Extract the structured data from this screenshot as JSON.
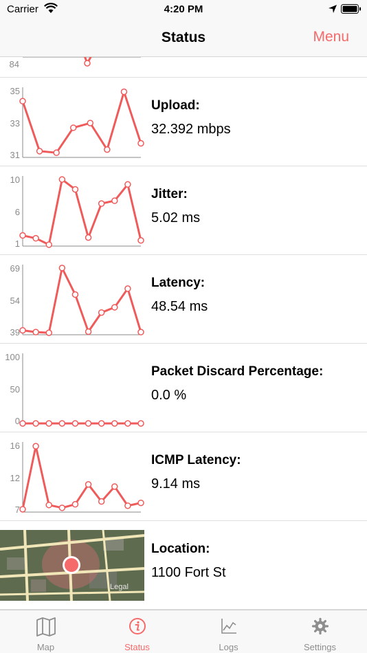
{
  "status_bar": {
    "carrier": "Carrier",
    "time": "4:20 PM"
  },
  "nav": {
    "title": "Status",
    "menu_label": "Menu"
  },
  "rows": [
    {
      "title": "",
      "value": "",
      "ticks": [
        "84"
      ],
      "chart": {
        "ylim": [
          84,
          99
        ],
        "values": []
      }
    },
    {
      "title": "Upload:",
      "value": "32.392 mbps",
      "ticks": [
        "35",
        "33",
        "31"
      ],
      "chart": {
        "ylim": [
          30.8,
          35.2
        ],
        "values": [
          34.4,
          31.2,
          31.1,
          32.7,
          33.0,
          31.3,
          35.0,
          31.7
        ]
      }
    },
    {
      "title": "Jitter:",
      "value": "5.02 ms",
      "ticks": [
        "10",
        "6",
        "1"
      ],
      "chart": {
        "ylim": [
          0.6,
          10.3
        ],
        "values": [
          2.1,
          1.7,
          0.8,
          10.0,
          8.6,
          1.8,
          6.6,
          7.0,
          9.3,
          1.4
        ]
      }
    },
    {
      "title": "Latency:",
      "value": "48.54 ms",
      "ticks": [
        "69",
        "54",
        "39"
      ],
      "chart": {
        "ylim": [
          38.2,
          69.5
        ],
        "values": [
          40.2,
          39.4,
          39.1,
          68.6,
          56.5,
          39.6,
          48.3,
          50.7,
          59.2,
          39.4
        ]
      }
    },
    {
      "title": "Packet Discard Percentage:",
      "value": "0.0 %",
      "ticks": [
        "100",
        "50",
        "0"
      ],
      "chart": {
        "ylim": [
          0,
          100
        ],
        "values": [
          0,
          0,
          0,
          0,
          0,
          0,
          0,
          0,
          0,
          0
        ]
      }
    },
    {
      "title": "ICMP Latency:",
      "value": "9.14 ms",
      "ticks": [
        "16",
        "12",
        "7"
      ],
      "chart": {
        "ylim": [
          6.6,
          16.3
        ],
        "values": [
          7.0,
          15.9,
          7.6,
          7.2,
          7.7,
          10.5,
          8.1,
          10.2,
          7.5,
          7.9
        ]
      }
    }
  ],
  "location": {
    "title": "Location:",
    "value": "1100 Fort St",
    "legal": "Legal"
  },
  "tabs": [
    {
      "label": "Map",
      "icon": "map-icon",
      "active": false
    },
    {
      "label": "Status",
      "icon": "info-icon",
      "active": true
    },
    {
      "label": "Logs",
      "icon": "chart-icon",
      "active": false
    },
    {
      "label": "Settings",
      "icon": "gear-icon",
      "active": false
    }
  ],
  "colors": {
    "accent": "#f56a6a",
    "line": "#ef5b5b",
    "axis": "#8a8a8a"
  }
}
